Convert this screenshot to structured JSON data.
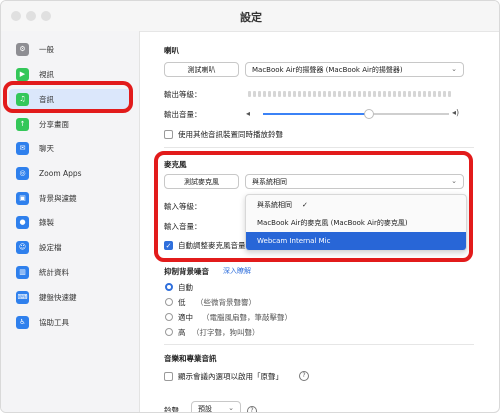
{
  "window": {
    "title": "設定"
  },
  "sidebar": {
    "items": [
      {
        "label": "一般",
        "icon": "gear-icon",
        "color": "#8e8e93"
      },
      {
        "label": "視訊",
        "icon": "video-icon",
        "color": "#34c759"
      },
      {
        "label": "音訊",
        "icon": "headphones-icon",
        "color": "#34c759",
        "active": true
      },
      {
        "label": "分享畫面",
        "icon": "share-screen-icon",
        "color": "#34c759"
      },
      {
        "label": "聊天",
        "icon": "chat-icon",
        "color": "#2f80ed"
      },
      {
        "label": "Zoom Apps",
        "icon": "apps-icon",
        "color": "#2f80ed"
      },
      {
        "label": "背景與濾鏡",
        "icon": "background-icon",
        "color": "#2f80ed"
      },
      {
        "label": "錄製",
        "icon": "record-icon",
        "color": "#2f80ed"
      },
      {
        "label": "設定檔",
        "icon": "profile-icon",
        "color": "#2f80ed"
      },
      {
        "label": "統計資料",
        "icon": "stats-icon",
        "color": "#2f80ed"
      },
      {
        "label": "鍵盤快速鍵",
        "icon": "keyboard-icon",
        "color": "#2f80ed"
      },
      {
        "label": "協助工具",
        "icon": "accessibility-icon",
        "color": "#2f80ed"
      }
    ]
  },
  "speaker": {
    "section_label": "喇叭",
    "test_button": "測試喇叭",
    "device": "MacBook Air的揚聲器 (MacBook Air的揚聲器)",
    "output_level_label": "輸出等級：",
    "output_volume_label": "輸出音量：",
    "output_volume_value": 0.57,
    "separate_device_label": "使用其他音訊裝置同時播放鈴聲"
  },
  "microphone": {
    "section_label": "麥克風",
    "test_button": "測試麥克風",
    "device": "與系統相同",
    "input_level_label": "輸入等級：",
    "input_volume_label": "輸入音量：",
    "auto_adjust_label": "自動調整麥克風音量",
    "dropdown_options": [
      {
        "label": "與系統相同",
        "checked": true
      },
      {
        "label": "MacBook Air的麥克風 (MacBook Air的麥克風)"
      },
      {
        "label": "Webcam Internal Mic",
        "selected": true
      }
    ]
  },
  "noise": {
    "section_label": "抑制背景噪音",
    "learn_more": "深入瞭解",
    "options": [
      {
        "label": "自動",
        "selected": true
      },
      {
        "label": "低",
        "hint": "（些微背景聲響）"
      },
      {
        "label": "適中",
        "hint": "（電腦風扇聲，筆敲擊聲）"
      },
      {
        "label": "高",
        "hint": "（打字聲，狗叫聲）"
      }
    ]
  },
  "music": {
    "section_label": "音樂和專業音訊",
    "option_label": "顯示會議內選項以啟用「原聲」"
  },
  "ringtone": {
    "label": "鈴聲",
    "value": "預設"
  },
  "colors": {
    "accent": "#2f6fdc",
    "highlight": "#e21b1b"
  }
}
